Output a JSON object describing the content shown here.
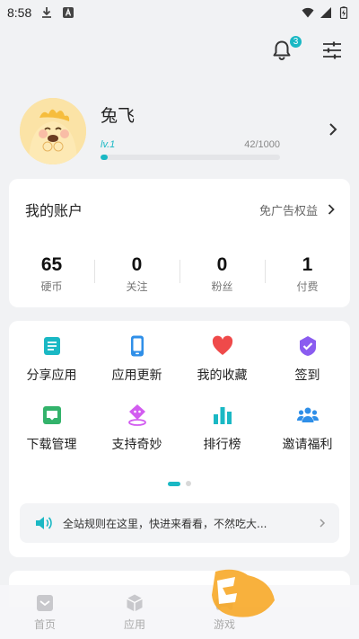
{
  "status_bar": {
    "time": "8:58"
  },
  "notifications": {
    "count": "3"
  },
  "profile": {
    "name": "兔飞",
    "level": "lv.1",
    "progress_text": "42/1000",
    "progress_fraction": 0.042
  },
  "account": {
    "title": "我的账户",
    "ad_link": "免广告权益",
    "stats": [
      {
        "value": "65",
        "label": "硬币"
      },
      {
        "value": "0",
        "label": "关注"
      },
      {
        "value": "0",
        "label": "粉丝"
      },
      {
        "value": "1",
        "label": "付费"
      }
    ]
  },
  "grid": {
    "items": [
      {
        "label": "分享应用",
        "icon": "share-app-icon",
        "color": "#1ab8c4"
      },
      {
        "label": "应用更新",
        "icon": "phone-update-icon",
        "color": "#2f8fe8"
      },
      {
        "label": "我的收藏",
        "icon": "heart-icon",
        "color": "#ef4a4a"
      },
      {
        "label": "签到",
        "icon": "checkin-icon",
        "color": "#8a5cf0"
      },
      {
        "label": "下载管理",
        "icon": "download-tray-icon",
        "color": "#33b36b"
      },
      {
        "label": "支持奇妙",
        "icon": "support-icon",
        "color": "#d25cf0"
      },
      {
        "label": "排行榜",
        "icon": "ranking-bars-icon",
        "color": "#1ab8c4"
      },
      {
        "label": "邀请福利",
        "icon": "invite-people-icon",
        "color": "#2f8fe8"
      }
    ]
  },
  "notice": {
    "text": "全站规则在这里，快进来看看，不然吃大..."
  },
  "bottom_nav": [
    {
      "label": "首页",
      "icon": "home-icon"
    },
    {
      "label": "应用",
      "icon": "app-box-icon"
    },
    {
      "label": "游戏",
      "icon": "gamepad-icon"
    },
    {
      "label": "",
      "icon": ""
    }
  ],
  "colors": {
    "accent": "#1ab8c4",
    "background": "#f1f2f4"
  }
}
